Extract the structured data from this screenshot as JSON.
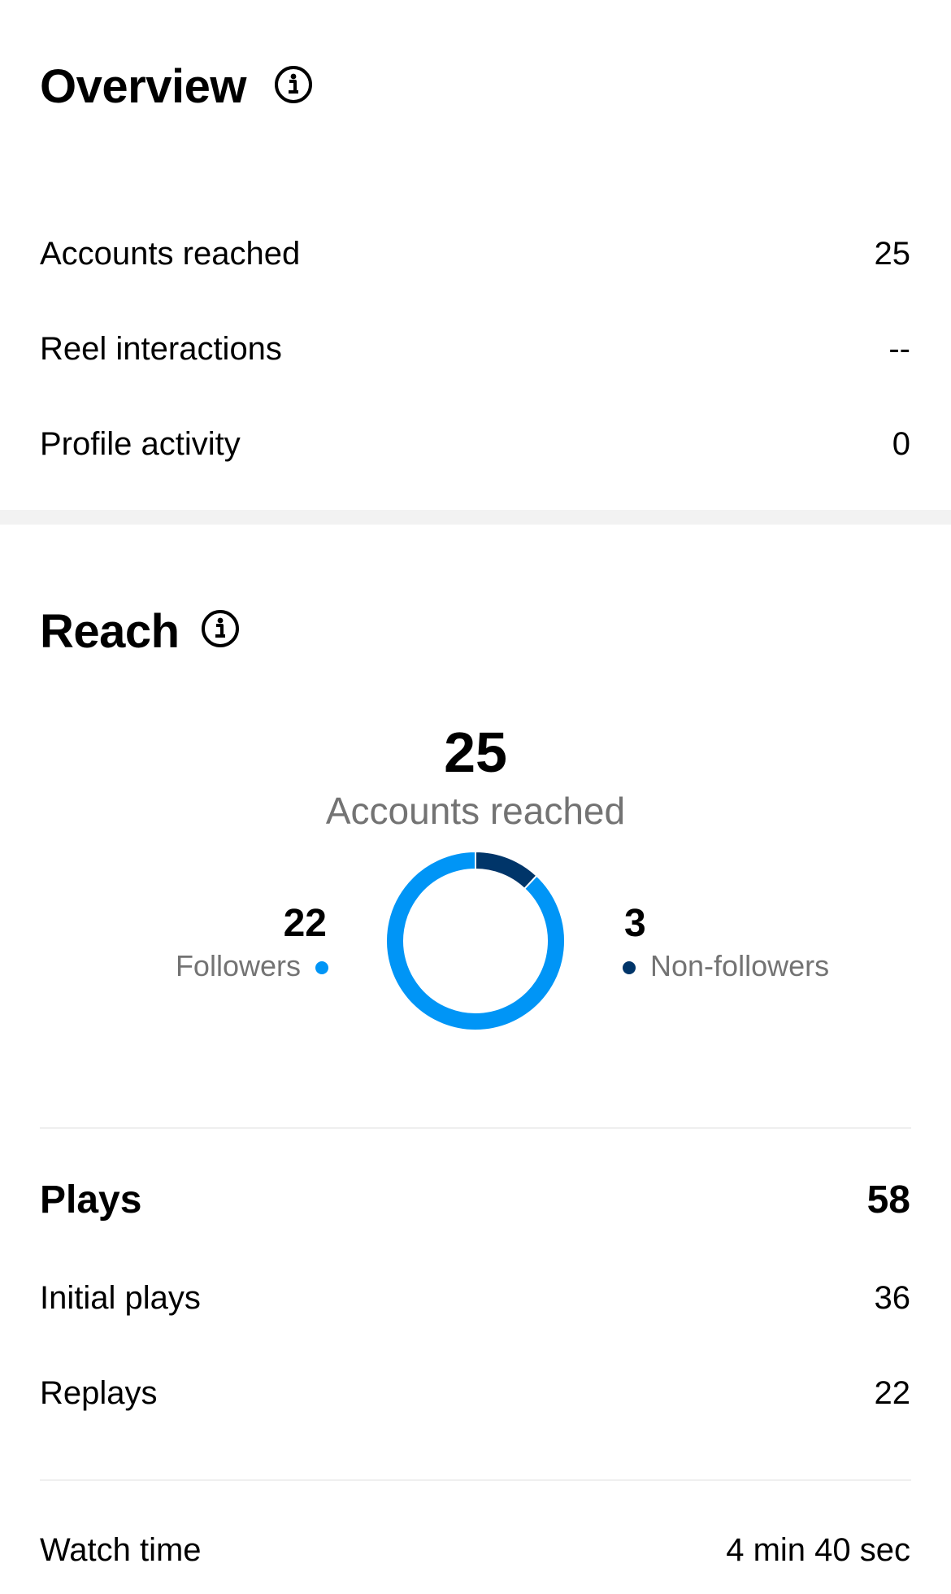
{
  "overview": {
    "title": "Overview",
    "info_icon": "info-circle-icon",
    "rows": [
      {
        "label": "Accounts reached",
        "value": "25"
      },
      {
        "label": "Reel interactions",
        "value": "--"
      },
      {
        "label": "Profile activity",
        "value": "0"
      }
    ]
  },
  "reach": {
    "title": "Reach",
    "info_icon": "info-circle-icon",
    "total": "25",
    "total_label": "Accounts reached",
    "followers": {
      "value": "22",
      "label": "Followers",
      "color": "#0095f6"
    },
    "non_followers": {
      "value": "3",
      "label": "Non-followers",
      "color": "#003569"
    }
  },
  "chart_data": {
    "type": "pie",
    "categories": [
      "Followers",
      "Non-followers"
    ],
    "values": [
      22,
      3
    ],
    "colors": [
      "#0095f6",
      "#003569"
    ],
    "title": "",
    "donut": true
  },
  "plays": {
    "title": "Plays",
    "value": "58",
    "rows": [
      {
        "label": "Initial plays",
        "value": "36"
      },
      {
        "label": "Replays",
        "value": "22"
      }
    ]
  },
  "watch_time": {
    "label": "Watch time",
    "value": "4 min 40 sec"
  }
}
